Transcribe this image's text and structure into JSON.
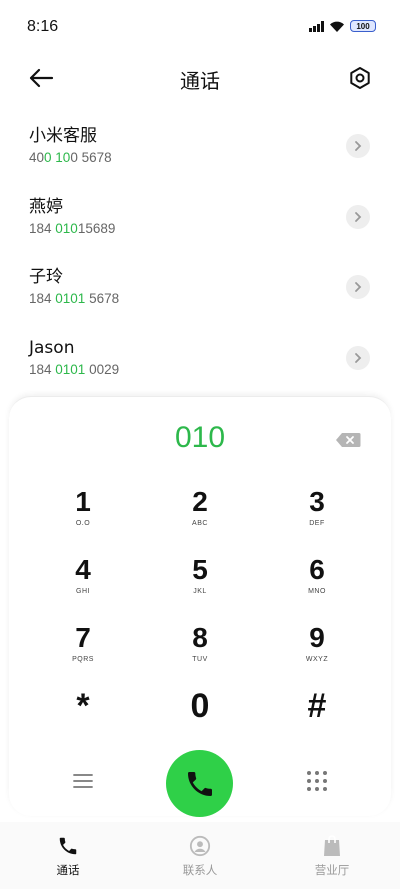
{
  "status_bar": {
    "time": "8:16",
    "battery": "100"
  },
  "header": {
    "title": "通话"
  },
  "contacts": [
    {
      "name": "小米客服",
      "number_parts": [
        "40",
        "0 10",
        "0 5678"
      ]
    },
    {
      "name": "燕婷",
      "number_parts": [
        "184 ",
        "010",
        "15689"
      ]
    },
    {
      "name": "子玲",
      "number_parts": [
        "184 ",
        "0101",
        " 5678"
      ]
    },
    {
      "name": "Jason",
      "number_parts": [
        "184 ",
        "0101",
        " 0029"
      ]
    }
  ],
  "dialer": {
    "input": "010",
    "keys": [
      {
        "digit": "1",
        "letters": "O.O"
      },
      {
        "digit": "2",
        "letters": "ABC"
      },
      {
        "digit": "3",
        "letters": "DEF"
      },
      {
        "digit": "4",
        "letters": "GHI"
      },
      {
        "digit": "5",
        "letters": "JKL"
      },
      {
        "digit": "6",
        "letters": "MNO"
      },
      {
        "digit": "7",
        "letters": "PQRS"
      },
      {
        "digit": "8",
        "letters": "TUV"
      },
      {
        "digit": "9",
        "letters": "WXYZ"
      },
      {
        "digit": "*",
        "letters": ""
      },
      {
        "digit": "0",
        "letters": ""
      },
      {
        "digit": "#",
        "letters": ""
      }
    ]
  },
  "bottom_nav": {
    "items": [
      {
        "label": "通话",
        "icon": "phone-icon",
        "active": true
      },
      {
        "label": "联系人",
        "icon": "person-icon",
        "active": false
      },
      {
        "label": "营业厅",
        "icon": "bag-icon",
        "active": false
      }
    ]
  },
  "colors": {
    "accent_green": "#2db84b",
    "call_button": "#2fd048",
    "inactive_nav": "#bbbbbb"
  }
}
